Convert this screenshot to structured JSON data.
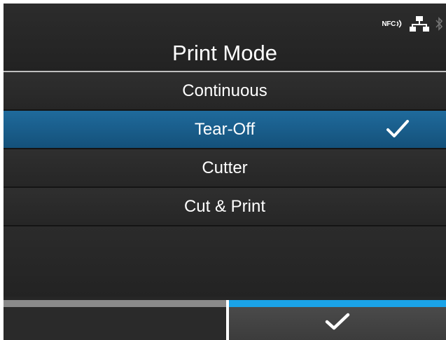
{
  "status_bar": {
    "nfc_label": "NFC",
    "icons": [
      "nfc-icon",
      "network-icon",
      "bluetooth-icon"
    ]
  },
  "title": "Print Mode",
  "options": [
    {
      "label": "Continuous",
      "selected": false
    },
    {
      "label": "Tear-Off",
      "selected": true
    },
    {
      "label": "Cutter",
      "selected": false
    },
    {
      "label": "Cut & Print",
      "selected": false
    }
  ],
  "footer": {
    "left_key": "",
    "right_key_icon": "checkmark-icon"
  },
  "colors": {
    "selected_row": "#1a5f8e",
    "accent_bar": "#1aa3e8",
    "background": "#262626"
  }
}
